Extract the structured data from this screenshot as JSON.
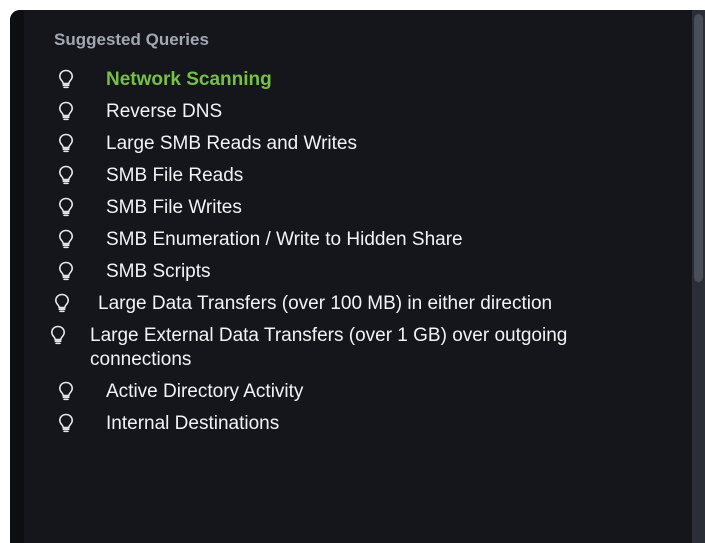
{
  "panel": {
    "title": "Suggested Queries",
    "accent_color": "#76c043",
    "item_icon": "lightbulb-icon"
  },
  "queries": [
    {
      "label": "Network Scanning",
      "active": true
    },
    {
      "label": "Reverse DNS",
      "active": false
    },
    {
      "label": "Large SMB Reads and Writes",
      "active": false
    },
    {
      "label": "SMB File Reads",
      "active": false
    },
    {
      "label": "SMB File Writes",
      "active": false
    },
    {
      "label": "SMB Enumeration / Write to Hidden Share",
      "active": false
    },
    {
      "label": "SMB Scripts",
      "active": false
    },
    {
      "label": "Large Data Transfers (over 100 MB) in either direction",
      "active": false
    },
    {
      "label": "Large External Data Transfers (over 1 GB) over outgoing connections",
      "active": false
    },
    {
      "label": "Active Directory Activity",
      "active": false
    },
    {
      "label": "Internal Destinations",
      "active": false
    }
  ]
}
